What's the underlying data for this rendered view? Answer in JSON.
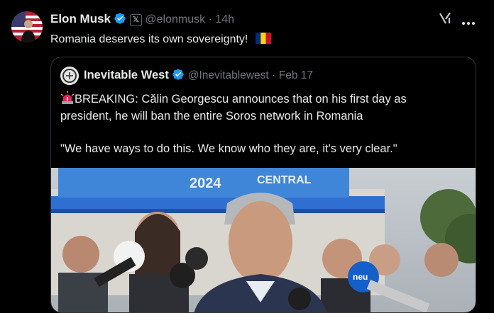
{
  "tweet": {
    "author_name": "Elon Musk",
    "author_handle": "@elonmusk",
    "separator": "·",
    "time": "14h",
    "text": "Romania deserves its own sovereignty!",
    "flag_emoji": "romania-flag",
    "affiliate_badge_glyph": "𝕏",
    "grok_icon": "grok-icon",
    "more_icon": "more-icon"
  },
  "quote": {
    "author_name": "Inevitable West",
    "author_handle": "@Inevitablewest",
    "separator": "·",
    "date": "Feb 17",
    "line1": "BREAKING: Călin Georgescu announces that on his first day as",
    "line2": "president, he will ban the entire Soros network in Romania",
    "line3": "\"We have ways to do this. We know who they are, it's very clear.\"",
    "siren_icon": "siren-icon",
    "banner_text": "2024",
    "banner_text2": "CENTRAL",
    "mic_logo": "neu"
  },
  "colors": {
    "verified_blue": "#1d9bf0",
    "background": "#000000",
    "text": "#e7e9ea",
    "muted": "#71767b",
    "border": "#2f3336"
  }
}
